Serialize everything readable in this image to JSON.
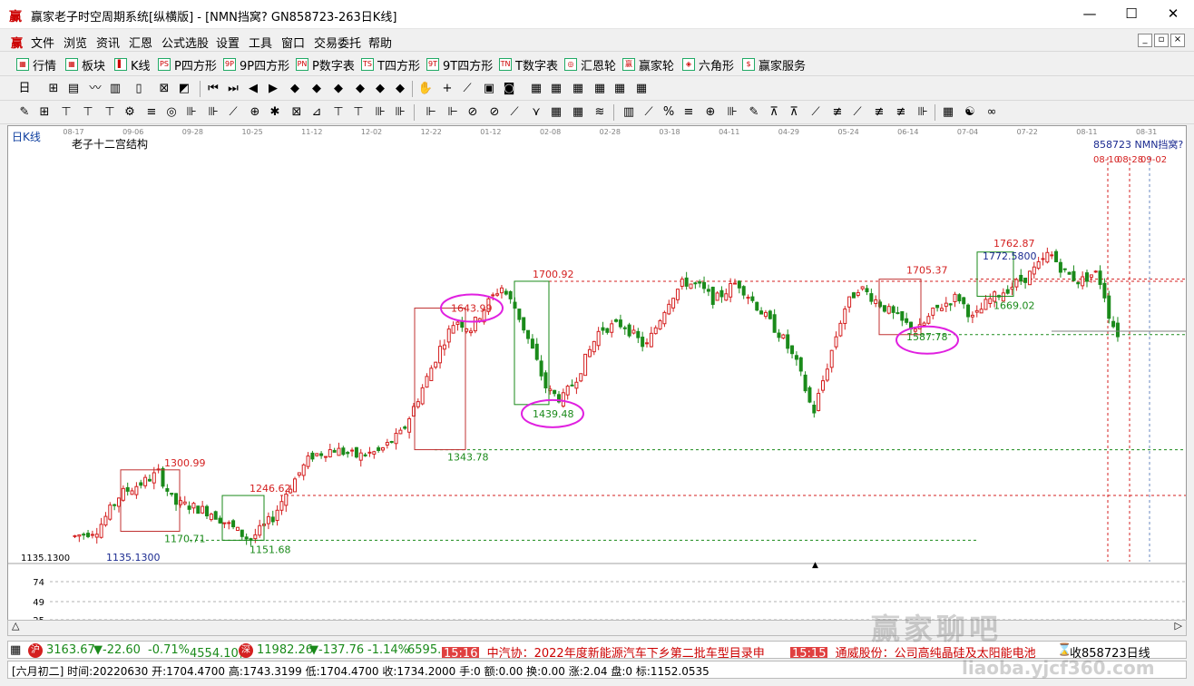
{
  "window": {
    "title": "赢家老子时空周期系统[纵横版] - [NMN挡窝? GN858723-263日K线]",
    "min": "—",
    "max": "☐",
    "close": "✕"
  },
  "menu": {
    "logo": "赢",
    "items": [
      "文件",
      "浏览",
      "资讯",
      "汇恩",
      "公式选股",
      "设置",
      "工具",
      "窗口",
      "交易委托",
      "帮助"
    ],
    "mdi": [
      "_",
      "▫",
      "×"
    ]
  },
  "toolbar1": [
    {
      "icon": "▦",
      "label": "行情"
    },
    {
      "icon": "▦",
      "label": "板块"
    },
    {
      "icon": "▌",
      "label": "K线"
    },
    {
      "icon": "PS",
      "label": "P四方形"
    },
    {
      "icon": "9P",
      "label": "9P四方形"
    },
    {
      "icon": "PN",
      "label": "P数字表"
    },
    {
      "icon": "TS",
      "label": "T四方形"
    },
    {
      "icon": "9T",
      "label": "9T四方形"
    },
    {
      "icon": "TN",
      "label": "T数字表"
    },
    {
      "icon": "◎",
      "label": "汇恩轮"
    },
    {
      "icon": "赢",
      "label": "赢家轮"
    },
    {
      "icon": "◈",
      "label": "六角形"
    },
    {
      "icon": "$",
      "label": "赢家服务"
    }
  ],
  "chart": {
    "period_label": "日K线",
    "indicator_name": "老子十二宫结构",
    "right_title": "858723 NMN挡窝?",
    "date_ticks": [
      "08-17",
      "09-06",
      "09-28",
      "10-25",
      "11-12",
      "12-02",
      "12-22",
      "01-12",
      "02-08",
      "02-28",
      "03-18",
      "04-11",
      "04-29",
      "05-24",
      "06-14",
      "07-04",
      "07-22",
      "08-11",
      "08-31"
    ],
    "future_dates": [
      "08-10",
      "08-28",
      "09-02"
    ],
    "left_price": "1135.1300",
    "low_axis": [
      "74",
      "49",
      "25"
    ],
    "prices": {
      "p1135": "1135.1300",
      "p1300": "1300.99",
      "p1170": "1170.71",
      "p1246": "1246.62",
      "p1151": "1151.68",
      "p1343": "1343.78",
      "p1643": "1643.99",
      "p1700": "1700.92",
      "p1439": "1439.48",
      "p1705": "1705.37",
      "p1587": "1587.78",
      "p1762": "1762.87",
      "p1772": "1772.5800",
      "p1669": "1669.02"
    },
    "colors": {
      "up": "#d42020",
      "down": "#1a8a1a",
      "ellipse": "#e020e0",
      "boxred": "#c03030",
      "boxgreen": "#1a8a1a"
    }
  },
  "status": {
    "sh_index": "3163.67",
    "sh_change": "▼-22.60",
    "sh_pct": "-0.71%",
    "sh_vol": "4554.10亿",
    "sz_index": "11982.26",
    "sz_change": "▼-137.76",
    "sz_pct": "-1.14%",
    "sz_vol": "6595.5",
    "news1_time": "15:16",
    "news1": "中汽协：2022年度新能源汽车下乡第二批车型目录申",
    "news2_time": "15:15",
    "news2": "通威股份：公司高纯晶硅及太阳能电池",
    "right": "收858723日线"
  },
  "status2": {
    "text": "[六月初二] 时间:20220630 开:1704.4700 高:1743.3199 低:1704.4700 收:1734.2000 手:0 额:0.00 换:0.00 涨:2.04 盘:0 标:1152.0535"
  },
  "watermark": {
    "main": "赢家聊吧",
    "sub": "liaoba.yjcf360.com"
  }
}
